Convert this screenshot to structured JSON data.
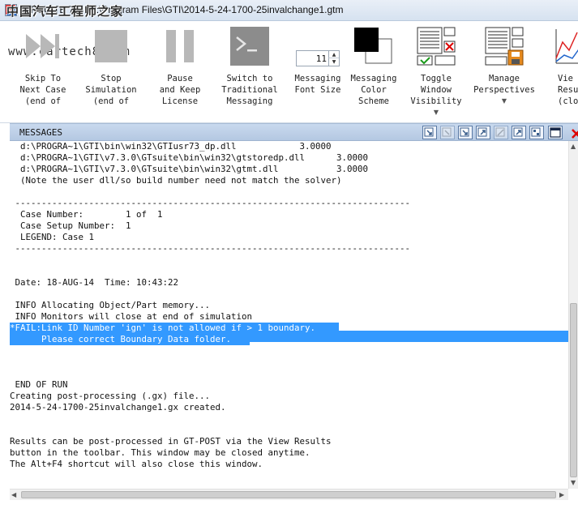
{
  "window": {
    "title": "GT-SUITE 7.3 - 2:\\Program Files\\GTI\\2014-5-24-1700-25invalchange1.gtm",
    "watermark": "中国汽车工程师之家",
    "watermark_url": "www.cartech8.com"
  },
  "toolbar": {
    "skip": {
      "label": "Skip To\nNext Case\n(end of",
      "icon": "skip-forward-icon"
    },
    "stop": {
      "label": "Stop\nSimulation\n(end of",
      "icon": "stop-icon"
    },
    "pause": {
      "label": "Pause\nand Keep\nLicense",
      "icon": "pause-icon"
    },
    "switch": {
      "label": "Switch to\nTraditional\nMessaging",
      "icon": "terminal-icon"
    },
    "font": {
      "label": "Messaging\nFont Size",
      "value": "11"
    },
    "color": {
      "label": "Messaging\nColor\nScheme",
      "icon": "color-scheme-icon"
    },
    "toggle": {
      "label": "Toggle\nWindow\nVisibility",
      "icon": "window-visibility-icon"
    },
    "perspectives": {
      "label": "Manage\nPerspectives",
      "icon": "perspectives-icon"
    },
    "results": {
      "label": "Vie\nResu\n(close",
      "icon": "results-chart-icon"
    }
  },
  "messages": {
    "header": "MESSAGES",
    "lines": [
      "  d:\\PROGRA~1\\GTI\\bin\\win32\\GTIusr73_dp.dll            3.0000",
      "  d:\\PROGRA~1\\GTI\\v7.3.0\\GTsuite\\bin\\win32\\gtstoredp.dll      3.0000",
      "  d:\\PROGRA~1\\GTI\\v7.3.0\\GTsuite\\bin\\win32\\gtmt.dll           3.0000",
      "  (Note the user dll/so build number need not match the solver)",
      "",
      " ---------------------------------------------------------------------------",
      "  Case Number:        1 of  1",
      "  Case Setup Number:  1",
      "  LEGEND: Case 1",
      " ---------------------------------------------------------------------------",
      "",
      "",
      " Date: 18-AUG-14  Time: 10:43:22",
      "",
      " INFO Allocating Object/Part memory...",
      " INFO Monitors will close at end of simulation",
      "*FAIL:Link ID Number 'ign' is not allowed if > 1 boundary.",
      "      Please correct Boundary Data folder.",
      "",
      "",
      "",
      " END OF RUN",
      "Creating post-processing (.gx) file...",
      "2014-5-24-1700-25invalchange1.gx created.",
      "",
      "",
      "Results can be post-processed in GT-POST via the View Results",
      "button in the toolbar. This window may be closed anytime.",
      "The Alt+F4 shortcut will also close this window."
    ]
  }
}
